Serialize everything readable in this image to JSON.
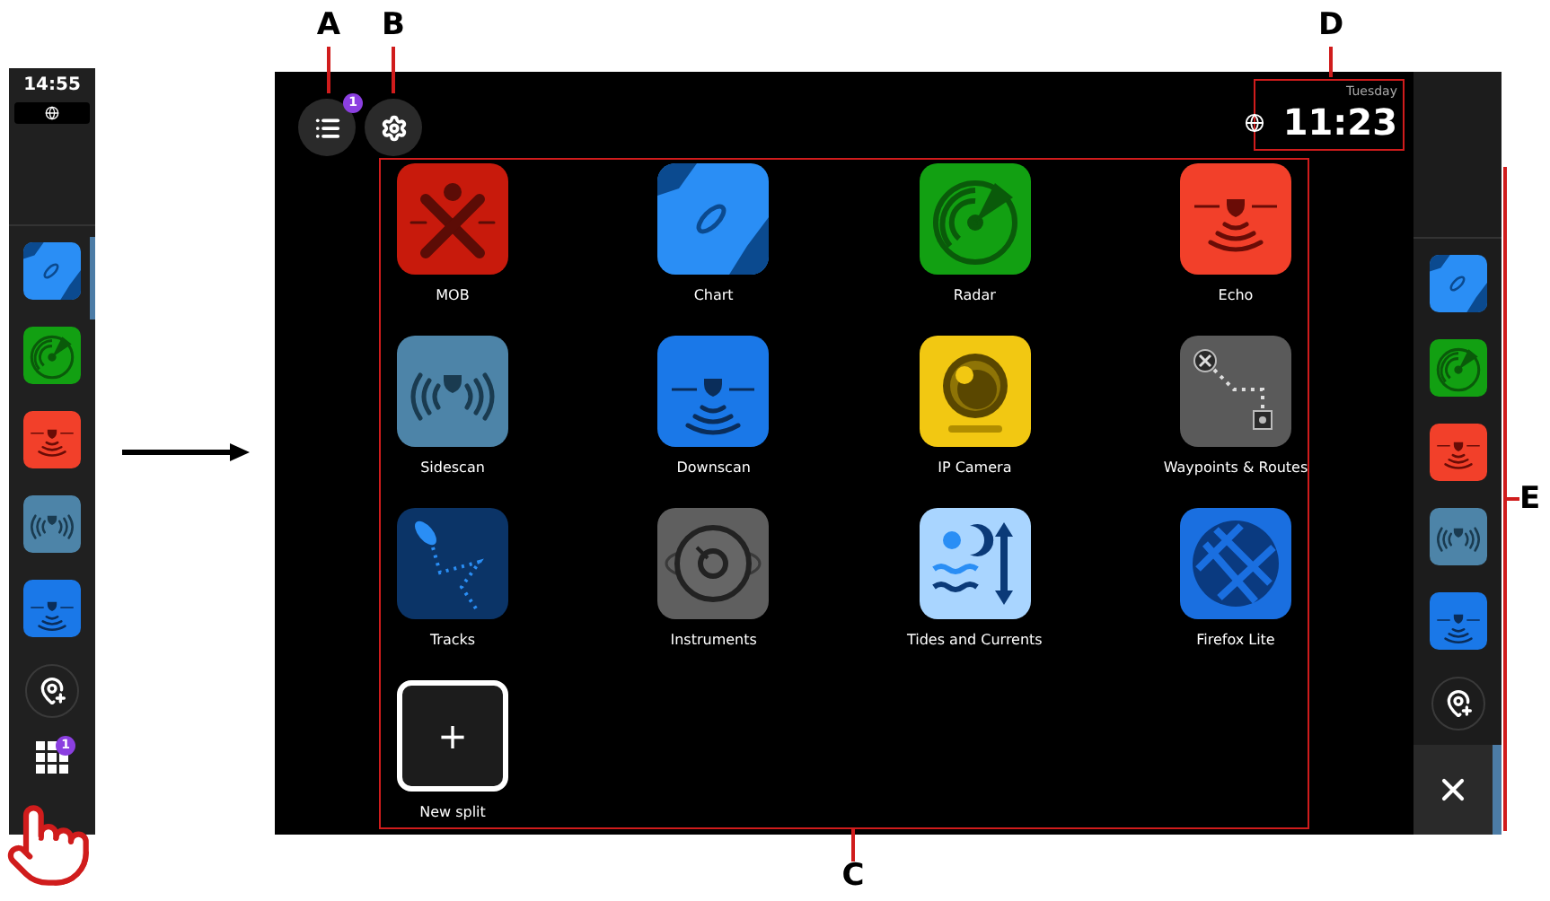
{
  "collapsed_sidebar": {
    "time": "14:55",
    "apps": [
      {
        "kind": "chart"
      },
      {
        "kind": "radar"
      },
      {
        "kind": "echo"
      },
      {
        "kind": "sidescan"
      },
      {
        "kind": "downscan"
      }
    ],
    "apps_badge": "1"
  },
  "screen": {
    "menu_badge": "1",
    "clock": {
      "day": "Tuesday",
      "time": "11:23"
    },
    "apps": [
      {
        "kind": "mob",
        "label": "MOB"
      },
      {
        "kind": "chart",
        "label": "Chart"
      },
      {
        "kind": "radar",
        "label": "Radar"
      },
      {
        "kind": "echo",
        "label": "Echo"
      },
      {
        "kind": "sidescan",
        "label": "Sidescan"
      },
      {
        "kind": "downscan",
        "label": "Downscan"
      },
      {
        "kind": "ipcamera",
        "label": "IP Camera"
      },
      {
        "kind": "waypoints",
        "label": "Waypoints & Routes"
      },
      {
        "kind": "tracks",
        "label": "Tracks"
      },
      {
        "kind": "instruments",
        "label": "Instruments"
      },
      {
        "kind": "tides",
        "label": "Tides and Currents"
      },
      {
        "kind": "firefox",
        "label": "Firefox Lite"
      }
    ],
    "new_split": {
      "symbol": "+",
      "label": "New split"
    },
    "sidebar": {
      "apps": [
        {
          "kind": "chart"
        },
        {
          "kind": "radar"
        },
        {
          "kind": "echo"
        },
        {
          "kind": "sidescan"
        },
        {
          "kind": "downscan"
        }
      ]
    }
  },
  "callouts": [
    {
      "letter": "A",
      "kind": "menu"
    },
    {
      "letter": "B",
      "kind": "settings"
    },
    {
      "letter": "C",
      "kind": "grid"
    },
    {
      "letter": "D",
      "kind": "clock"
    },
    {
      "letter": "E",
      "kind": "sidebar"
    }
  ]
}
